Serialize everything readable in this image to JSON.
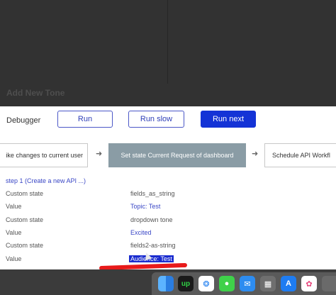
{
  "editor": {
    "section_title": "Add New Tone"
  },
  "debugger": {
    "label": "Debugger",
    "run_label": "Run",
    "run_slow_label": "Run slow",
    "run_next_label": "Run next"
  },
  "steps": [
    {
      "label": "ike changes to current user"
    },
    {
      "label": "Set state Current Request of dashboard",
      "active": true
    },
    {
      "label": "Schedule API Workfl"
    }
  ],
  "step_link": "step 1 (Create a new API ...)",
  "rows": [
    {
      "key": "Custom state",
      "value": "fields_as_string"
    },
    {
      "key": "Value",
      "value": "Topic: Test"
    },
    {
      "key": "Custom state",
      "value": "dropdown tone"
    },
    {
      "key": "Value",
      "value": "Excited"
    },
    {
      "key": "Custom state",
      "value": "fields2-as-string"
    },
    {
      "key": "Value",
      "value": "Audience: Test"
    }
  ],
  "dock": {
    "apps": [
      "finder-icon",
      "upwork-icon",
      "safari-icon",
      "messages-icon",
      "mail-icon",
      "launchpad-icon",
      "app-store-icon",
      "photos-icon"
    ],
    "upwork_text": "up"
  },
  "colors": {
    "accent_blue": "#1433d6",
    "link_blue": "#3a47c6",
    "active_step": "#8a9ca5",
    "underline_red": "#e81a1a"
  }
}
